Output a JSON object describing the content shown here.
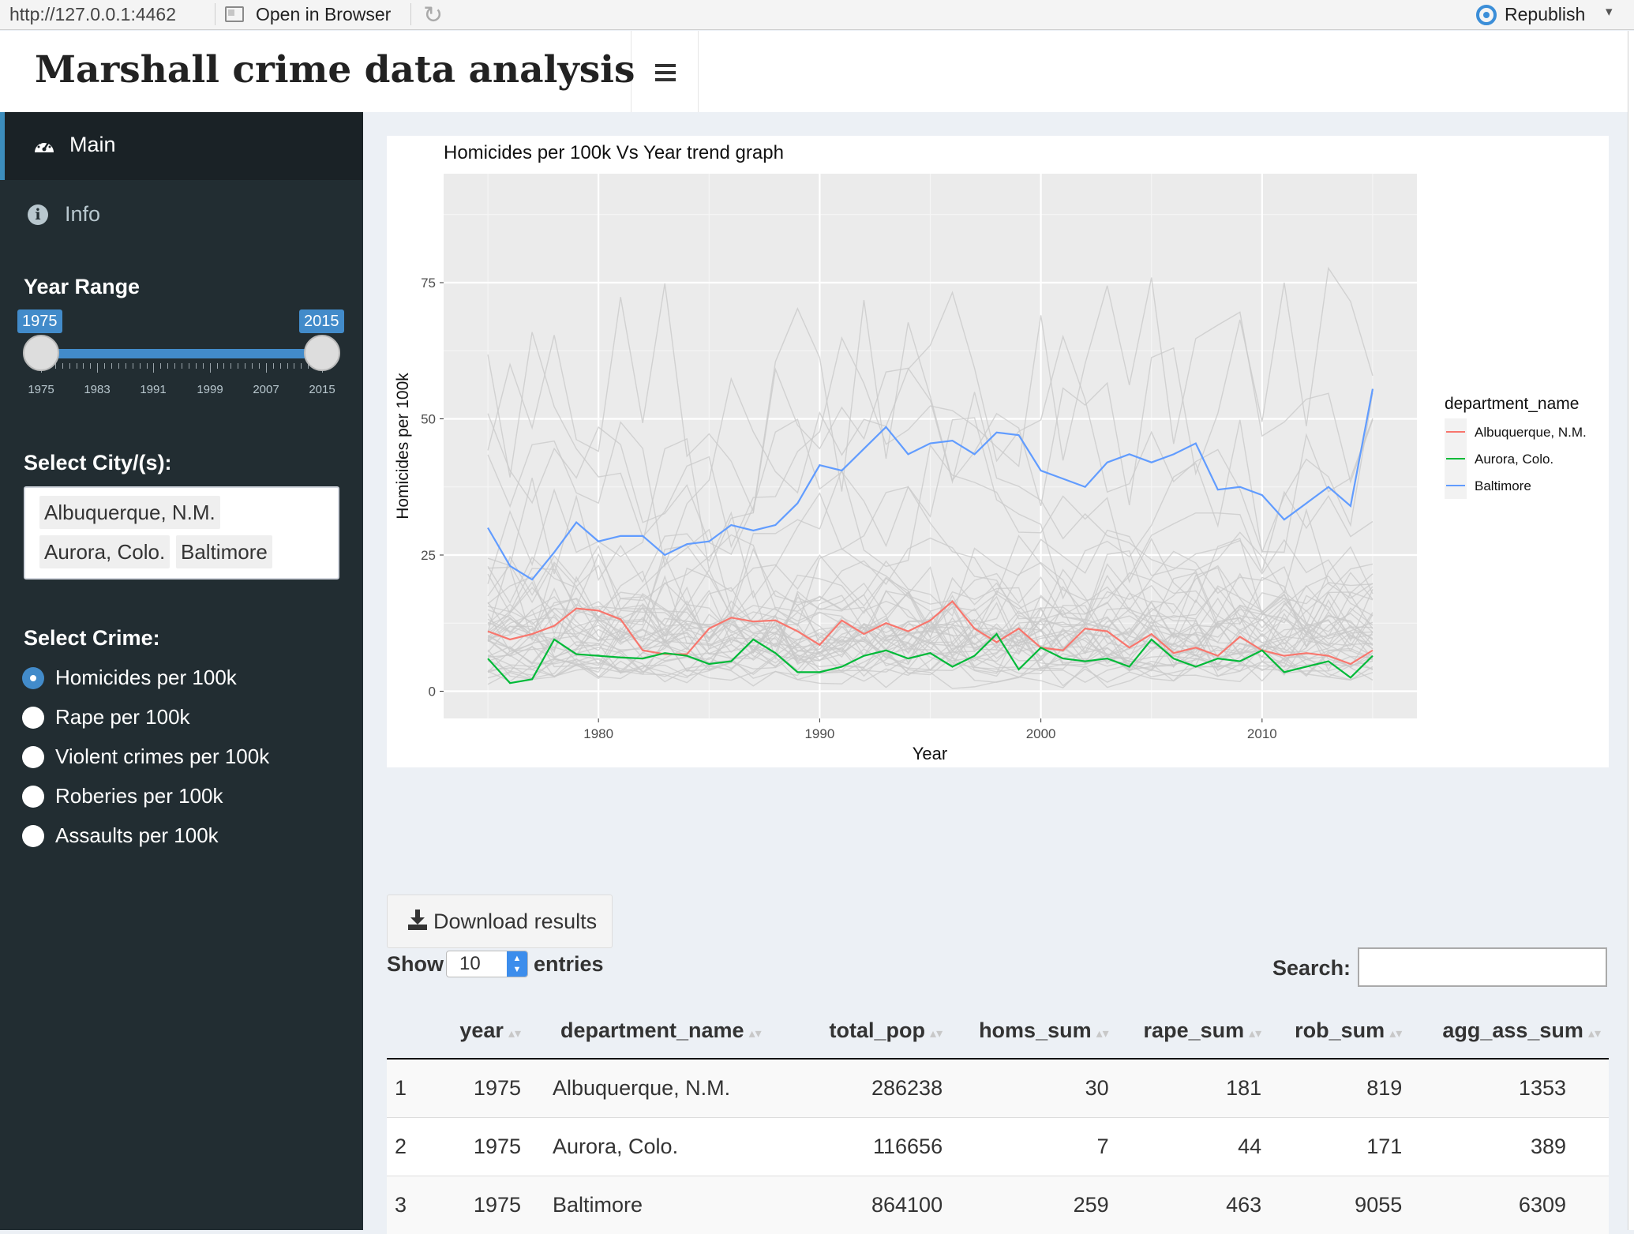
{
  "topbar": {
    "url": "http://127.0.0.1:4462",
    "open_in_browser": "Open in Browser",
    "publish": "Republish"
  },
  "header": {
    "title": "Marshall crime data analysis"
  },
  "sidebar": {
    "menu": [
      {
        "label": "Main",
        "icon": "dashboard-icon",
        "active": true
      },
      {
        "label": "Info",
        "icon": "info-icon",
        "active": false
      }
    ],
    "year_range": {
      "label": "Year Range",
      "from": "1975",
      "to": "2015",
      "min": 1975,
      "max": 2015,
      "ticks": [
        "1975",
        "1983",
        "1991",
        "1999",
        "2007",
        "2015"
      ]
    },
    "city_select": {
      "label": "Select City/(s):",
      "selected": [
        "Albuquerque, N.M.",
        "Aurora, Colo.",
        "Baltimore"
      ]
    },
    "crime_select": {
      "label": "Select Crime:",
      "options": [
        "Homicides per 100k",
        "Rape per 100k",
        "Violent crimes per 100k",
        "Roberies per 100k",
        "Assaults per 100k"
      ],
      "selected_index": 0
    }
  },
  "chart_data": {
    "type": "line",
    "title": "Homicides per 100k Vs Year trend graph",
    "xlabel": "Year",
    "ylabel": "Homicides per 100k",
    "xlim": [
      1973,
      2017
    ],
    "ylim": [
      -5,
      95
    ],
    "xticks": [
      1980,
      1990,
      2000,
      2010
    ],
    "yticks": [
      0,
      25,
      50,
      75
    ],
    "legend_title": "department_name",
    "legend_position": "right",
    "background_series_color": "#c8c8c8",
    "x": [
      1975,
      1976,
      1977,
      1978,
      1979,
      1980,
      1981,
      1982,
      1983,
      1984,
      1985,
      1986,
      1987,
      1988,
      1989,
      1990,
      1991,
      1992,
      1993,
      1994,
      1995,
      1996,
      1997,
      1998,
      1999,
      2000,
      2001,
      2002,
      2003,
      2004,
      2005,
      2006,
      2007,
      2008,
      2009,
      2010,
      2011,
      2012,
      2013,
      2014,
      2015
    ],
    "series": [
      {
        "name": "Albuquerque, N.M.",
        "color": "#f8766d",
        "values": [
          11,
          9.5,
          10.5,
          12,
          15.2,
          14.8,
          13.2,
          7.5,
          6.8,
          6.8,
          11.5,
          13.5,
          12.8,
          13,
          11,
          8.5,
          13,
          10.5,
          12.5,
          11,
          13,
          16.5,
          11.5,
          9,
          11.5,
          8,
          7.5,
          11.5,
          11,
          8,
          10.5,
          7,
          8,
          6.5,
          10,
          7.5,
          6.5,
          7,
          6.5,
          5,
          7.5
        ]
      },
      {
        "name": "Aurora, Colo.",
        "color": "#00ba38",
        "values": [
          6,
          1.5,
          2.2,
          9.5,
          6.8,
          6.5,
          6.2,
          6,
          7,
          6.5,
          5,
          5.5,
          9.5,
          7,
          3.5,
          3.5,
          4.5,
          6.5,
          7.5,
          6,
          7,
          4.5,
          6.5,
          10.5,
          4,
          8,
          6,
          5.5,
          6,
          4.5,
          9.5,
          6,
          4.5,
          6,
          5.5,
          7.5,
          3.5,
          4.5,
          5.5,
          2.5,
          6.5
        ]
      },
      {
        "name": "Baltimore",
        "color": "#619cff",
        "values": [
          30,
          23,
          20.5,
          25.5,
          31,
          27.5,
          28.5,
          28.5,
          25,
          27,
          27.5,
          30.5,
          29.5,
          30.5,
          34.5,
          41.5,
          40.5,
          44.5,
          48.5,
          43.5,
          45.5,
          46,
          43.5,
          47.5,
          47,
          40.5,
          39,
          37.5,
          42,
          43.5,
          42,
          43.5,
          45.5,
          37,
          37.5,
          36,
          31.5,
          34.5,
          37.5,
          34,
          55.5
        ]
      }
    ]
  },
  "download": {
    "label": "Download results"
  },
  "table": {
    "show_label": "Show",
    "entries_value": "10",
    "entries_label": "entries",
    "search_label": "Search:",
    "search_value": "",
    "columns": [
      "",
      "year",
      "department_name",
      "total_pop",
      "homs_sum",
      "rape_sum",
      "rob_sum",
      "agg_ass_sum"
    ],
    "rows": [
      [
        "1",
        "1975",
        "Albuquerque, N.M.",
        "286238",
        "30",
        "181",
        "819",
        "1353"
      ],
      [
        "2",
        "1975",
        "Aurora, Colo.",
        "116656",
        "7",
        "44",
        "171",
        "389"
      ],
      [
        "3",
        "1975",
        "Baltimore",
        "864100",
        "259",
        "463",
        "9055",
        "6309"
      ]
    ]
  }
}
